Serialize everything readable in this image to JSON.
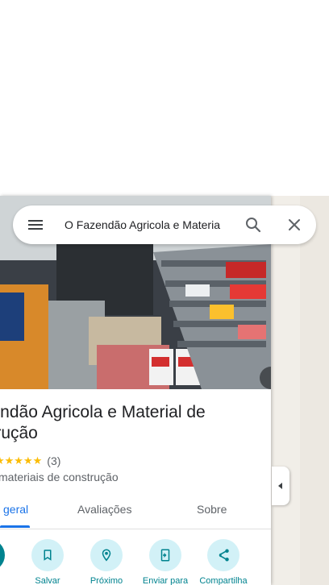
{
  "search": {
    "query": "O Fazendão Agricola e Materia"
  },
  "place": {
    "title": "zendão Agricola e Material de\nstrução",
    "stars": "★★★★★",
    "rating_count": "(3)",
    "category": "materiais de construção"
  },
  "tabs": [
    {
      "label": "geral",
      "active": true
    },
    {
      "label": "Avaliações",
      "active": false
    },
    {
      "label": "Sobre",
      "active": false
    }
  ],
  "actions": [
    {
      "label": "",
      "icon": "directions-icon"
    },
    {
      "label": "Salvar",
      "icon": "bookmark-icon"
    },
    {
      "label": "Próximo",
      "icon": "nearby-icon"
    },
    {
      "label": "Enviar para",
      "icon": "send-to-phone-icon"
    },
    {
      "label": "Compartilha",
      "icon": "share-icon"
    }
  ],
  "colors": {
    "accent": "#00838f",
    "tab_active": "#1a73e8",
    "action_bg": "#d2f1f7",
    "star": "#fbbc04"
  }
}
